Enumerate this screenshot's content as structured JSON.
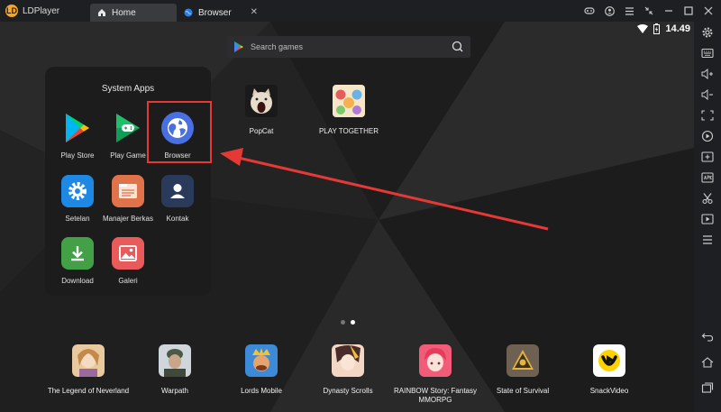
{
  "app": {
    "name": "LDPlayer"
  },
  "tabs": [
    {
      "label": "Home",
      "icon": "home-icon"
    },
    {
      "label": "Browser",
      "icon": "globe-icon",
      "close": "✕"
    }
  ],
  "status": {
    "time": "14.49"
  },
  "search": {
    "placeholder": "Search games"
  },
  "folder": {
    "title": "System Apps",
    "apps": [
      {
        "label": "Play Store"
      },
      {
        "label": "Play Game"
      },
      {
        "label": "Browser"
      },
      {
        "label": "Setelan"
      },
      {
        "label": "Manajer Berkas"
      },
      {
        "label": "Kontak"
      },
      {
        "label": "Download"
      },
      {
        "label": "Galeri"
      }
    ]
  },
  "desktop": {
    "shortcuts": [
      {
        "label": "PopCat"
      },
      {
        "label": "PLAY TOGETHER"
      }
    ]
  },
  "dock": [
    {
      "label": "The Legend of Neverland"
    },
    {
      "label": "Warpath"
    },
    {
      "label": "Lords Mobile"
    },
    {
      "label": "Dynasty Scrolls"
    },
    {
      "label": "RAINBOW Story: Fantasy MMORPG"
    },
    {
      "label": "State of Survival"
    },
    {
      "label": "SnackVideo"
    }
  ],
  "colors": {
    "highlight": "#e53935",
    "arrow": "#e53935"
  }
}
